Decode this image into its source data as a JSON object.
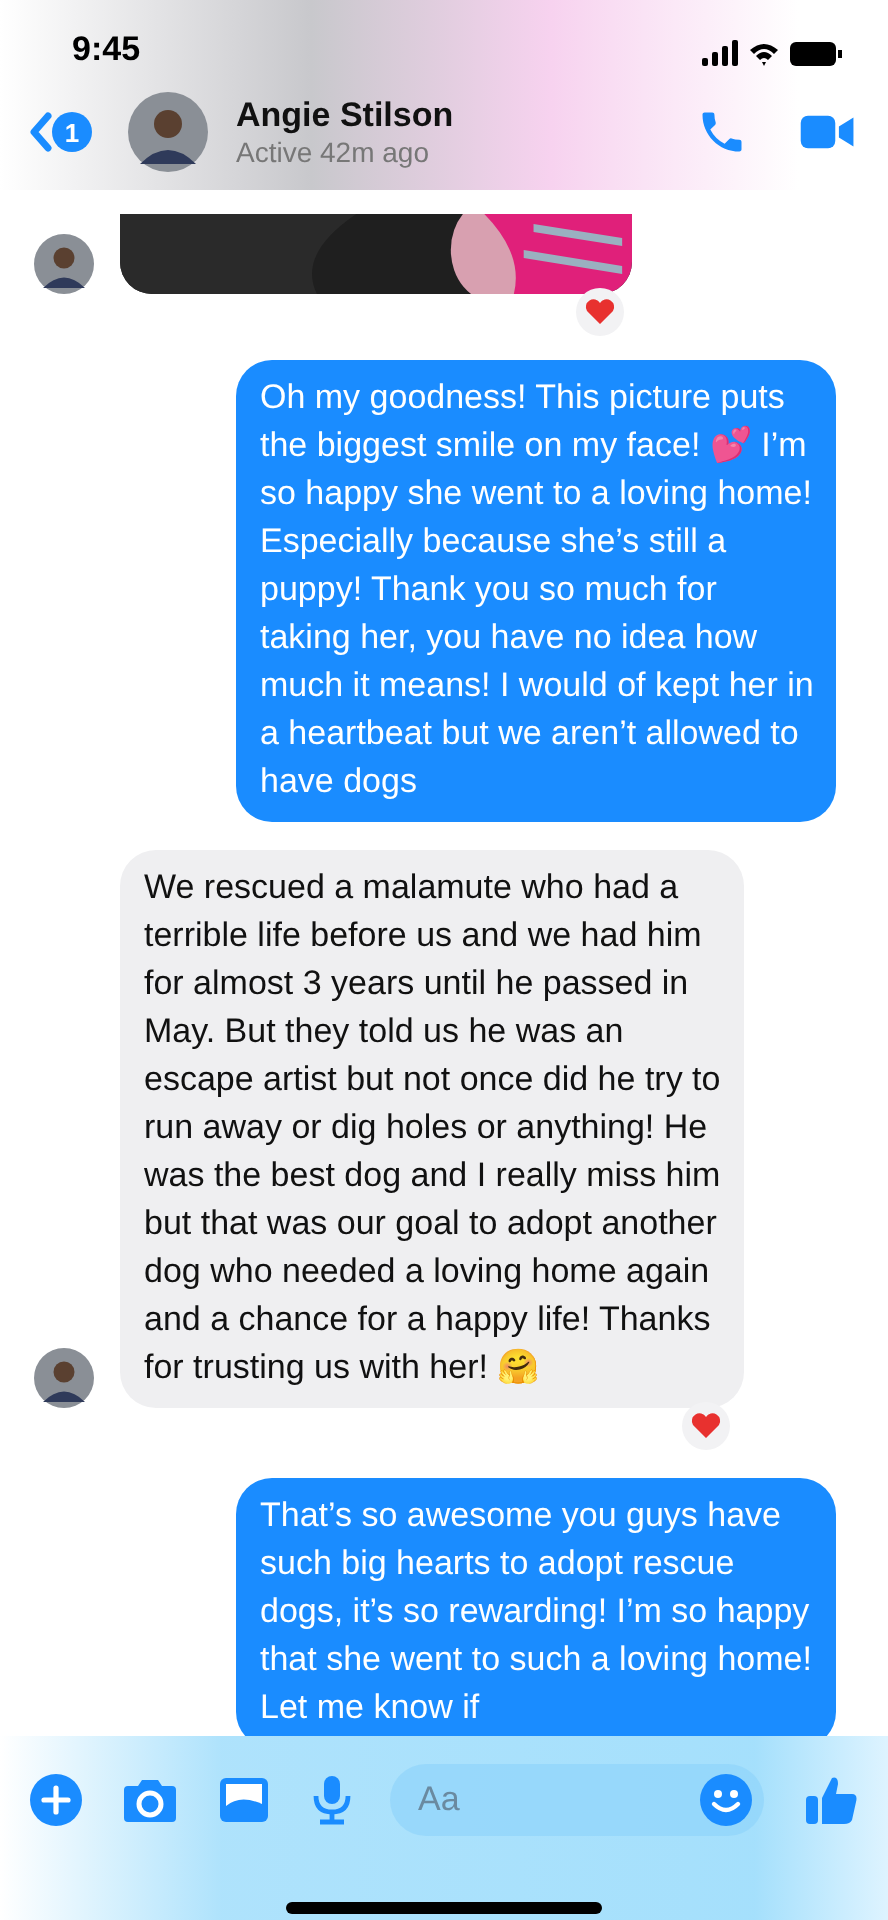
{
  "status_bar": {
    "time": "9:45"
  },
  "header": {
    "unread_count": "1",
    "name": "Angie Stilson",
    "status": "Active 42m ago"
  },
  "messages": [
    {
      "kind": "photo_received",
      "avatar": true,
      "reaction": true
    },
    {
      "kind": "sent",
      "text": "Oh my goodness! This picture puts the biggest smile on my face! 💕 I’m so happy she went to a loving home! Especially because she’s still a puppy! Thank you so much for taking her, you have no idea how much it means! I would of kept her in a heartbeat but we aren’t allowed to have dogs"
    },
    {
      "kind": "received",
      "text": "We rescued a malamute who had a terrible life before us and we had him for almost 3 years until he passed in May. But they told us he was an escape artist but not once did he try to run away or dig holes or anything! He was the best dog and I really miss him but that was our goal to adopt another dog who needed a loving home again and a chance for a happy life! Thanks for trusting us with her! 🤗",
      "avatar": true,
      "reaction": true
    },
    {
      "kind": "sent",
      "text": "That’s so awesome you guys have such big hearts to adopt rescue dogs, it’s so rewarding! I’m so happy that she went to such a loving home! Let me know if"
    }
  ],
  "composer": {
    "placeholder": "Aa"
  }
}
